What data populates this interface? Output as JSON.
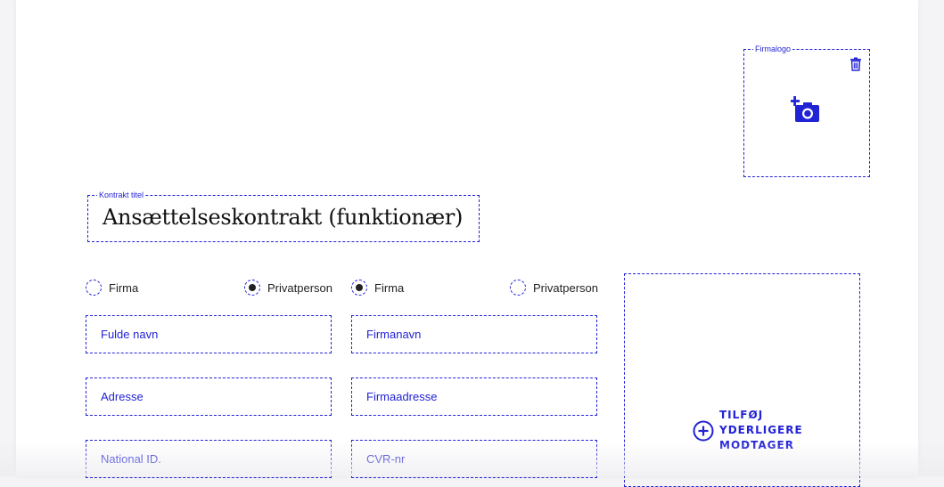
{
  "logo": {
    "legend": "Firmalogo",
    "icons": {
      "delete": "trash-icon",
      "upload": "camera-plus-icon"
    }
  },
  "contract": {
    "legend": "Kontrakt titel",
    "title": "Ansættelseskontrakt (funktionær)"
  },
  "party_left": {
    "radio_options": [
      {
        "label": "Firma",
        "selected": false
      },
      {
        "label": "Privatperson",
        "selected": true
      }
    ],
    "fields": [
      {
        "placeholder": "Fulde navn"
      },
      {
        "placeholder": "Adresse"
      },
      {
        "placeholder": "National ID."
      }
    ]
  },
  "party_right": {
    "radio_options": [
      {
        "label": "Firma",
        "selected": true
      },
      {
        "label": "Privatperson",
        "selected": false
      }
    ],
    "fields": [
      {
        "placeholder": "Firmanavn"
      },
      {
        "placeholder": "Firmaadresse"
      },
      {
        "placeholder": "CVR-nr"
      }
    ]
  },
  "add_recipient": {
    "label": "TILFØJ YDERLIGERE MODTAGER",
    "icon": "plus-circle-icon"
  },
  "colors": {
    "accent": "#2323d6",
    "text": "#111111",
    "background": "#ffffff"
  }
}
